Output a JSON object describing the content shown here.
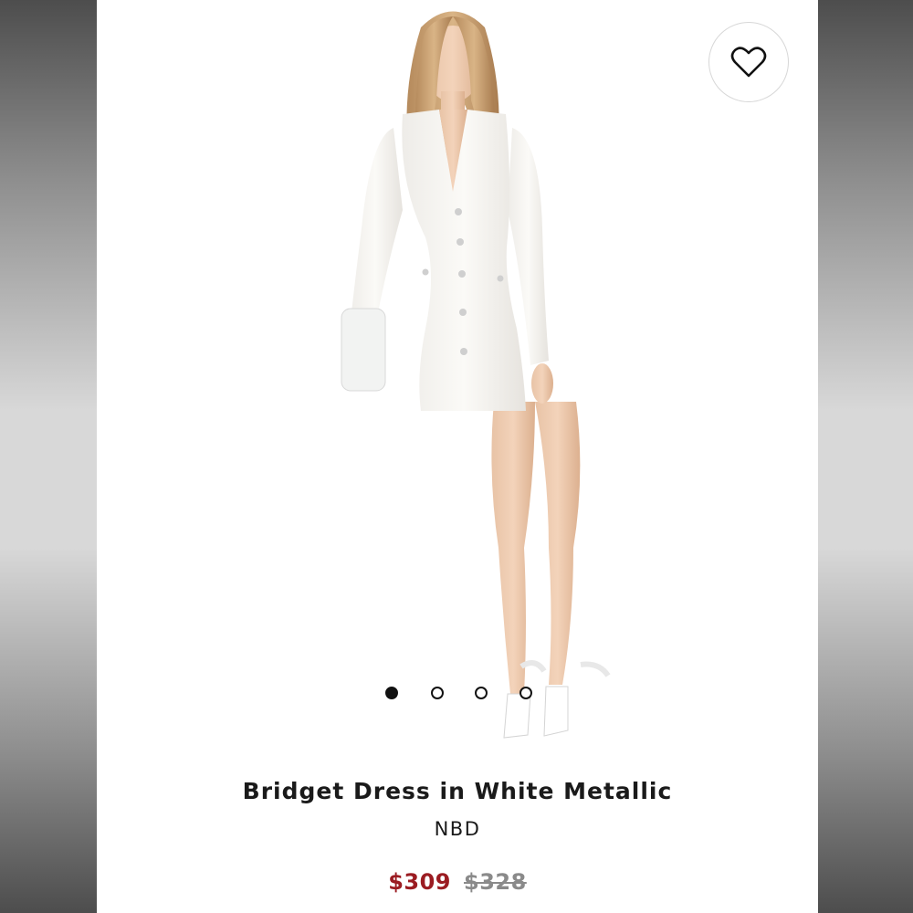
{
  "product": {
    "title": "Bridget Dress in White Metallic",
    "brand": "NBD",
    "price_sale": "$309",
    "price_original": "$328",
    "image_alt": "Model wearing white tweed button-front mini dress with white clutch and white heels"
  },
  "carousel": {
    "count": 4,
    "active_index": 0
  },
  "icons": {
    "favorite": "heart-outline-icon"
  },
  "colors": {
    "sale_price": "#9b1c22",
    "original_price": "#8a8a8a",
    "text": "#1a1a1a",
    "background": "#ffffff"
  }
}
